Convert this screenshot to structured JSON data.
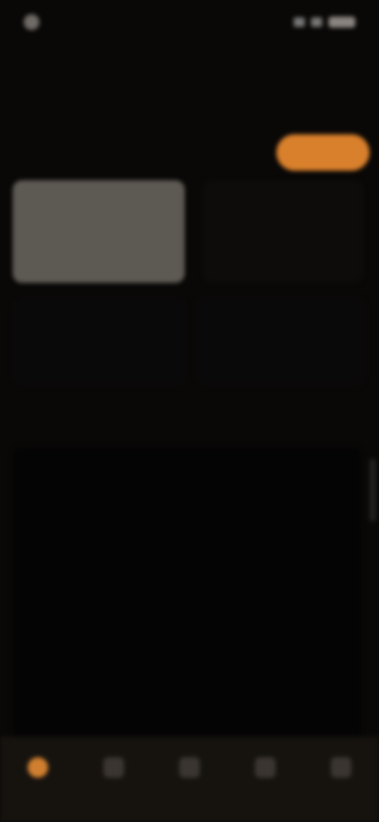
{
  "status": {
    "time": "",
    "dot_color": "#6f6b66"
  },
  "header": {
    "title": "",
    "subtitle_parts": [
      "",
      ""
    ],
    "action_label": "",
    "small_text": ""
  },
  "cards": [
    {
      "value": ""
    },
    {
      "value": ""
    },
    {
      "value": ""
    },
    {
      "value": ""
    }
  ],
  "section": {
    "label": "",
    "tab": "",
    "more": ""
  },
  "list": [
    {
      "title": "",
      "link": ""
    },
    {
      "title": "",
      "link": ""
    },
    {
      "title": "",
      "link": ""
    },
    {
      "title": "",
      "link": ""
    }
  ],
  "nav": [
    {
      "icon": "home-icon",
      "label": ""
    },
    {
      "icon": "doc-icon",
      "label": ""
    },
    {
      "icon": "center-icon",
      "label": ""
    },
    {
      "icon": "chart-icon",
      "label": ""
    },
    {
      "icon": "user-icon",
      "label": ""
    }
  ],
  "colors": {
    "accent": "#d9802c",
    "background": "#0a0807",
    "nav_bg": "#16130f"
  }
}
